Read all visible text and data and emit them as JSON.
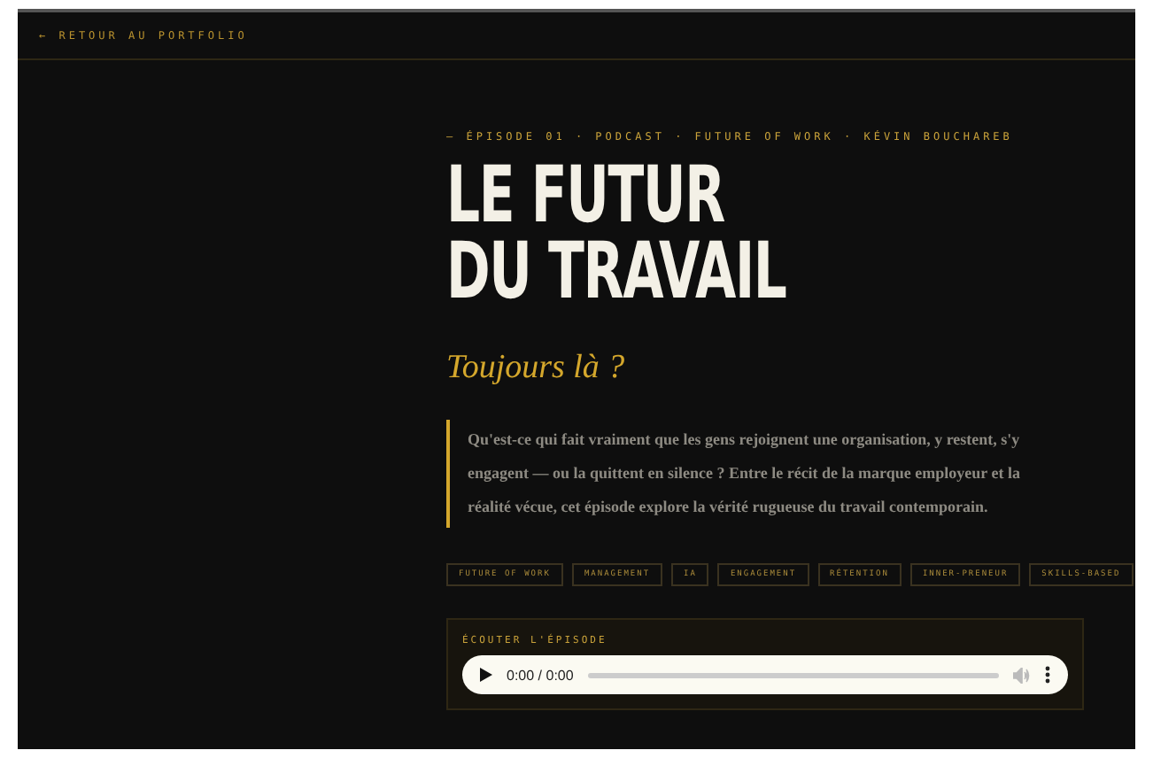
{
  "nav": {
    "back_link": "← RETOUR AU PORTFOLIO"
  },
  "meta": "— ÉPISODE 01 · PODCAST · FUTURE OF WORK · KÉVIN BOUCHAREB",
  "title_lines": [
    "LE FUTUR",
    "DU TRAVAIL"
  ],
  "subtitle": "Toujours là ?",
  "intro": "Qu'est-ce qui fait vraiment que les gens rejoignent une organisation, y restent, s'y engagent — ou la quittent en silence ? Entre le récit de la marque employeur et la réalité vécue, cet épisode explore la vérité rugueuse du travail contemporain.",
  "tags": [
    "FUTURE OF WORK",
    "MANAGEMENT",
    "IA",
    "ENGAGEMENT",
    "RÉTENTION",
    "INNER-PRENEUR",
    "SKILLS-BASED"
  ],
  "player": {
    "label": "ÉCOUTER L'ÉPISODE",
    "time": "0:00 / 0:00"
  }
}
